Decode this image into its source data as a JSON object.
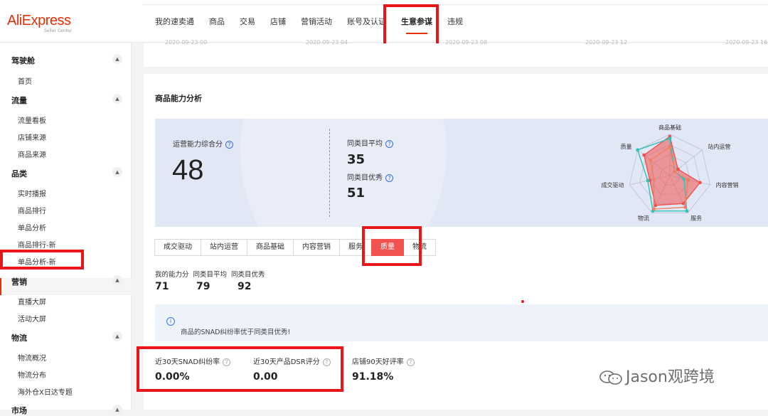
{
  "logo": {
    "name": "AliExpress",
    "tagline": "Seller Center"
  },
  "top_nav": [
    {
      "label": "我的速卖通"
    },
    {
      "label": "商品"
    },
    {
      "label": "交易"
    },
    {
      "label": "店铺"
    },
    {
      "label": "营销活动"
    },
    {
      "label": "账号及认证"
    },
    {
      "label": "生意参谋",
      "active": true
    },
    {
      "label": "违规"
    }
  ],
  "date_ticks": [
    "2020-09-23 00",
    "2020-09-23 04",
    "2020-09-23 08",
    "2020-09-23 12",
    "2020-09-23 16"
  ],
  "sidebar": {
    "groups": [
      {
        "title": "驾驶舱",
        "items": [
          "首页"
        ]
      },
      {
        "title": "流量",
        "items": [
          "流量看板",
          "店铺来源",
          "商品来源"
        ]
      },
      {
        "title": "品类",
        "items": [
          "实时播报",
          "商品排行",
          "单品分析",
          "商品排行-新",
          "单品分析-新"
        ]
      },
      {
        "title": "营销",
        "items": [
          "直播大屏",
          "活动大屏"
        ]
      },
      {
        "title": "物流",
        "items": [
          "物流概况",
          "物流分布",
          "海外仓X日达专题"
        ]
      },
      {
        "title": "市场",
        "items": []
      }
    ],
    "toggle_glyph": "▲"
  },
  "panel": {
    "title": "商品能力分析",
    "overall": {
      "label": "运营能力综合分",
      "value": "48"
    },
    "category_avg": {
      "label": "同类目平均",
      "value": "35"
    },
    "category_best": {
      "label": "同类目优秀",
      "value": "51"
    },
    "help_glyph": "?"
  },
  "radar": {
    "axes": [
      "商品基础",
      "站内运营",
      "内容营销",
      "服务",
      "物流",
      "成交驱动",
      "质量"
    ],
    "max": 100,
    "series": [
      {
        "values": [
          95,
          25,
          75,
          75,
          80,
          50,
          80
        ],
        "color": "#f0524f"
      },
      {
        "values": [
          90,
          15,
          35,
          95,
          95,
          55,
          100
        ],
        "color": "#2bc4b7"
      },
      {
        "values": [
          70,
          15,
          45,
          85,
          90,
          40,
          60
        ],
        "color": "#f07f62"
      }
    ]
  },
  "tabs": [
    {
      "label": "成交驱动"
    },
    {
      "label": "站内运营"
    },
    {
      "label": "商品基础"
    },
    {
      "label": "内容营销"
    },
    {
      "label": "服务"
    },
    {
      "label": "质量",
      "active": true
    },
    {
      "label": "物流"
    }
  ],
  "tab_metrics": {
    "labels": [
      "我的能力分",
      "同类目平均",
      "同类目优秀"
    ],
    "values": [
      "71",
      "79",
      "92"
    ]
  },
  "notice": {
    "icon": "i",
    "text": "商品的SNAD纠纷率优于同类目优秀!"
  },
  "stats": [
    {
      "label": "近30天SNAD纠纷率",
      "value": "0.00%"
    },
    {
      "label": "近30天产品DSR评分",
      "value": "0.00"
    },
    {
      "label": "店铺90天好评率",
      "value": "91.18%"
    }
  ],
  "watermark": "Jason观跨境"
}
